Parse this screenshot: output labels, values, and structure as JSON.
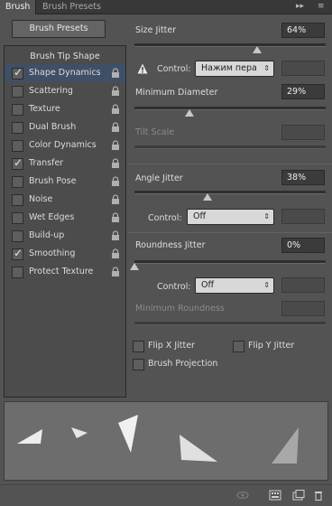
{
  "tabs": [
    {
      "label": "Brush",
      "active": true
    },
    {
      "label": "Brush Presets",
      "active": false
    }
  ],
  "tabbar": {
    "collapse_glyph": "▸▸",
    "menu_glyph": "≡"
  },
  "left": {
    "presets_button": "Brush Presets",
    "tip_shape": "Brush Tip Shape",
    "options": [
      {
        "label": "Shape Dynamics",
        "checked": true,
        "selected": true
      },
      {
        "label": "Scattering",
        "checked": false
      },
      {
        "label": "Texture",
        "checked": false
      },
      {
        "label": "Dual Brush",
        "checked": false
      },
      {
        "label": "Color Dynamics",
        "checked": false
      },
      {
        "label": "Transfer",
        "checked": true
      },
      {
        "label": "Brush Pose",
        "checked": false
      },
      {
        "label": "Noise",
        "checked": false
      },
      {
        "label": "Wet Edges",
        "checked": false
      },
      {
        "label": "Build-up",
        "checked": false
      },
      {
        "label": "Smoothing",
        "checked": true
      },
      {
        "label": "Protect Texture",
        "checked": false
      }
    ]
  },
  "right": {
    "size_jitter": {
      "label": "Size Jitter",
      "value": "64%",
      "level": 0.64
    },
    "size_control": {
      "label": "Control:",
      "value": "Нажим пера"
    },
    "min_diameter": {
      "label": "Minimum Diameter",
      "value": "29%",
      "level": 0.29
    },
    "tilt_scale": {
      "label": "Tilt Scale"
    },
    "angle_jitter": {
      "label": "Angle Jitter",
      "value": "38%",
      "level": 0.38
    },
    "angle_control": {
      "label": "Control:",
      "value": "Off"
    },
    "roundness_jitter": {
      "label": "Roundness Jitter",
      "value": "0%",
      "level": 0
    },
    "roundness_control": {
      "label": "Control:",
      "value": "Off"
    },
    "min_roundness": {
      "label": "Minimum Roundness"
    },
    "flip_x": {
      "label": "Flip X Jitter",
      "checked": false
    },
    "flip_y": {
      "label": "Flip Y Jitter",
      "checked": false
    },
    "brush_projection": {
      "label": "Brush Projection",
      "checked": false
    }
  },
  "icons": {
    "checkmark": "✓",
    "dropdown_arrow": "⇕"
  },
  "colors": {
    "panel_bg": "#535353",
    "selected_row": "#3f4f66",
    "preview_bg": "#6d6d6d"
  }
}
